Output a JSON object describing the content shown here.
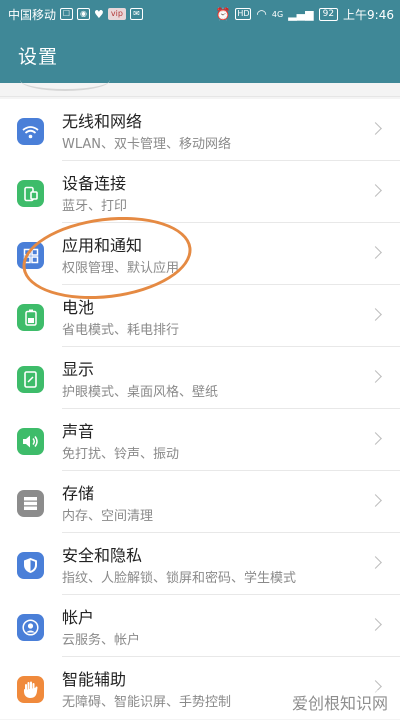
{
  "status_bar": {
    "carrier": "中国移动",
    "badge_text": "vip",
    "network_type": "4G",
    "battery": "92",
    "time": "上午9:46"
  },
  "header": {
    "title": "设置"
  },
  "settings": [
    {
      "title": "无线和网络",
      "subtitle": "WLAN、双卡管理、移动网络",
      "icon": "wifi-icon",
      "color": "#4a7fd8"
    },
    {
      "title": "设备连接",
      "subtitle": "蓝牙、打印",
      "icon": "device-connection-icon",
      "color": "#3ebc6a"
    },
    {
      "title": "应用和通知",
      "subtitle": "权限管理、默认应用",
      "icon": "apps-grid-icon",
      "color": "#4a7fd8"
    },
    {
      "title": "电池",
      "subtitle": "省电模式、耗电排行",
      "icon": "battery-icon",
      "color": "#3ebc6a"
    },
    {
      "title": "显示",
      "subtitle": "护眼模式、桌面风格、壁纸",
      "icon": "display-icon",
      "color": "#3ebc6a"
    },
    {
      "title": "声音",
      "subtitle": "免打扰、铃声、振动",
      "icon": "sound-icon",
      "color": "#3ebc6a"
    },
    {
      "title": "存储",
      "subtitle": "内存、空间清理",
      "icon": "storage-icon",
      "color": "#8c8c8c"
    },
    {
      "title": "安全和隐私",
      "subtitle": "指纹、人脸解锁、锁屏和密码、学生模式",
      "icon": "shield-icon",
      "color": "#4a7fd8"
    },
    {
      "title": "帐户",
      "subtitle": "云服务、帐户",
      "icon": "account-icon",
      "color": "#4a7fd8"
    },
    {
      "title": "智能辅助",
      "subtitle": "无障碍、智能识屏、手势控制",
      "icon": "hand-icon",
      "color": "#f08a3c"
    }
  ],
  "watermark": "爱创根知识网"
}
